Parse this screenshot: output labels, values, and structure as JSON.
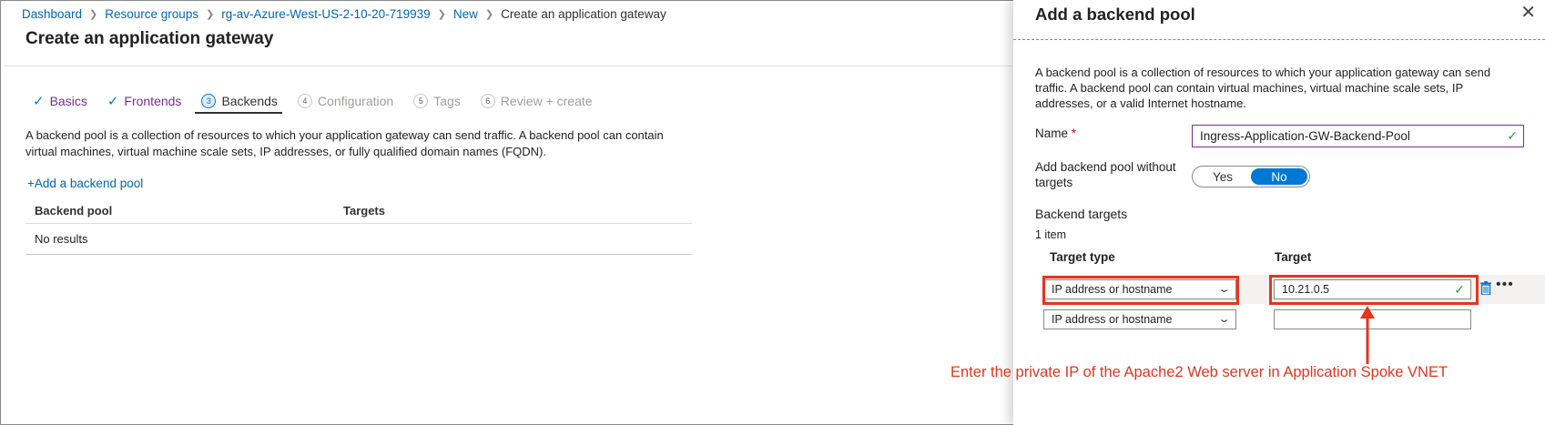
{
  "breadcrumb": {
    "items": [
      "Dashboard",
      "Resource groups",
      "rg-av-Azure-West-US-2-10-20-719939",
      "New"
    ],
    "current": "Create an application gateway"
  },
  "page": {
    "title": "Create an application gateway",
    "tabs": [
      {
        "label": "Basics",
        "state": "done"
      },
      {
        "label": "Frontends",
        "state": "done"
      },
      {
        "num": "3",
        "label": "Backends",
        "state": "active"
      },
      {
        "num": "4",
        "label": "Configuration",
        "state": "disabled"
      },
      {
        "num": "5",
        "label": "Tags",
        "state": "disabled"
      },
      {
        "num": "6",
        "label": "Review + create",
        "state": "disabled"
      }
    ],
    "description": "A backend pool is a collection of resources to which your application gateway can send traffic. A backend pool can contain virtual machines, virtual machine scale sets, IP addresses, or fully qualified domain names (FQDN).",
    "add_link": "+Add a backend pool",
    "table": {
      "columns": [
        "Backend pool",
        "Targets"
      ],
      "empty": "No results"
    }
  },
  "blade": {
    "title": "Add a backend pool",
    "close": "✕",
    "description": "A backend pool is a collection of resources to which your application gateway can send traffic. A backend pool can contain virtual machines, virtual machine scale sets, IP addresses, or a valid Internet hostname.",
    "name_label": "Name",
    "name_required": "*",
    "name_value": "Ingress-Application-GW-Backend-Pool",
    "without_targets_label": "Add backend pool without targets",
    "toggle": {
      "yes": "Yes",
      "no": "No",
      "selected": "No"
    },
    "targets_heading": "Backend targets",
    "targets_count": "1 item",
    "columns": {
      "type": "Target type",
      "target": "Target"
    },
    "rows": [
      {
        "type": "IP address or hostname",
        "target": "10.21.0.5"
      },
      {
        "type": "IP address or hostname",
        "target": ""
      }
    ]
  },
  "annotation": {
    "text": "Enter the private IP of the Apache2 Web server in Application Spoke VNET",
    "color": "#e8341c"
  },
  "colors": {
    "link": "#0066b8",
    "accent": "#0078d4",
    "visited_tab": "#7a2d9b",
    "valid": "#2e9e3a"
  }
}
